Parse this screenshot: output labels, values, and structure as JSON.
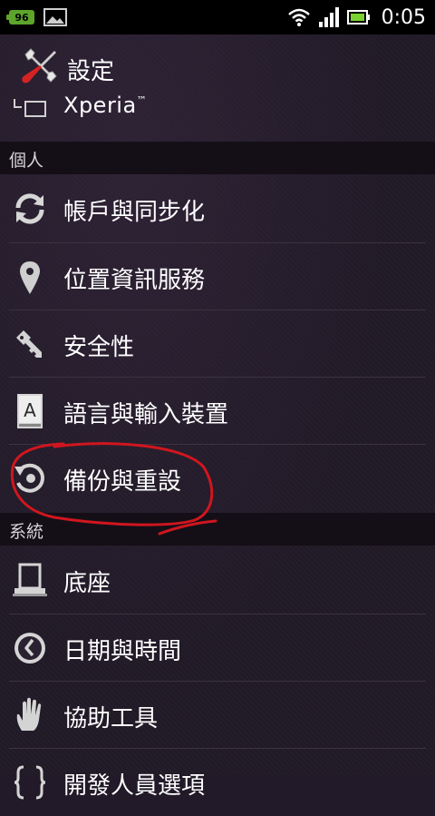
{
  "status_bar": {
    "battery_badge": "96",
    "time": "0:05",
    "icons": [
      "battery-level-icon",
      "image-notification-icon",
      "wifi-icon",
      "signal-icon",
      "battery-icon"
    ]
  },
  "header": {
    "title": "設定",
    "subtitle": "Xperia",
    "subtitle_tm": "™",
    "icons": [
      "tools-icon",
      "dock-icon"
    ]
  },
  "sections": {
    "personal": "個人",
    "system": "系統"
  },
  "personal_items": [
    {
      "label": "帳戶與同步化",
      "icon": "sync-icon"
    },
    {
      "label": "位置資訊服務",
      "icon": "location-pin-icon"
    },
    {
      "label": "安全性",
      "icon": "key-icon"
    },
    {
      "label": "語言與輸入裝置",
      "icon": "language-icon"
    },
    {
      "label": "備份與重設",
      "icon": "backup-restore-icon"
    }
  ],
  "system_items": [
    {
      "label": "底座",
      "icon": "dock-stand-icon"
    },
    {
      "label": "日期與時間",
      "icon": "clock-icon"
    },
    {
      "label": "協助工具",
      "icon": "hand-icon"
    },
    {
      "label": "開發人員選項",
      "icon": "developer-icon"
    }
  ],
  "colors": {
    "background": "#221a28",
    "section_header": "#140f17",
    "annotation_stroke": "#d0161e",
    "battery_green": "#5da52a"
  }
}
